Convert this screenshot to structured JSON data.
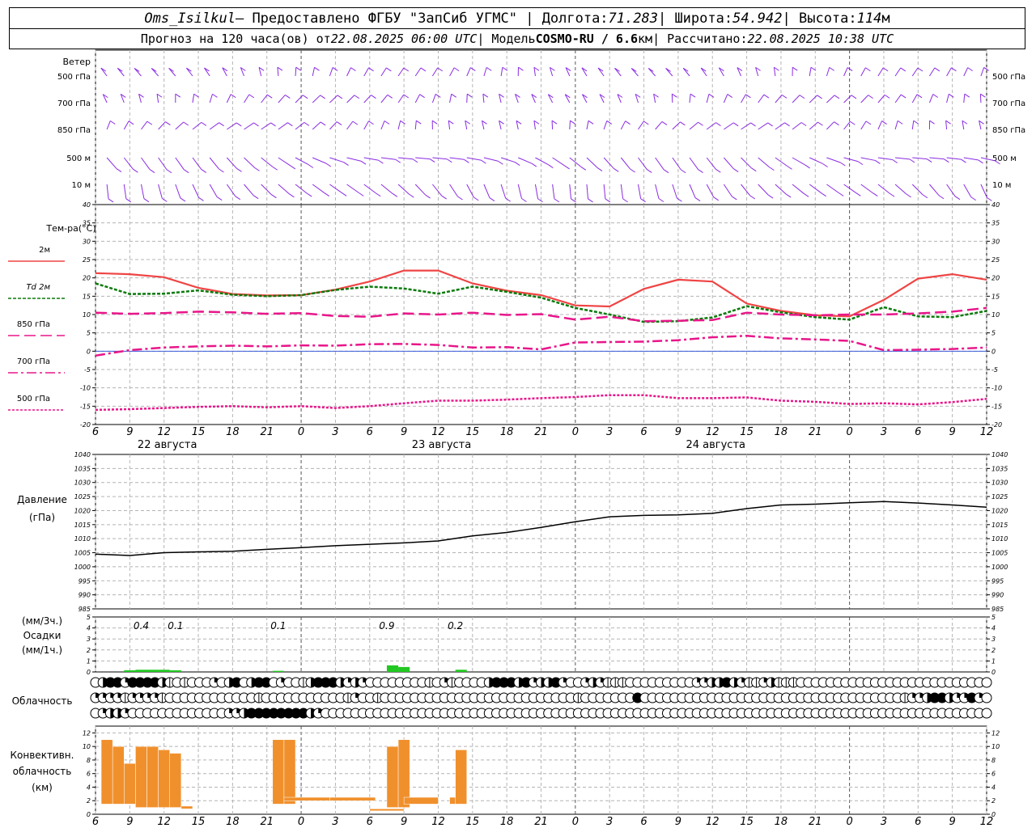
{
  "header": {
    "station": "Oms_Isilkul",
    "provider_prefix": " – Предоставлено ФГБУ \"ЗапСиб УГМС\" | Долгота: ",
    "longitude": "71.283",
    "lat_prefix": " | Широта: ",
    "latitude": "54.942",
    "alt_prefix": " | Высота: ",
    "altitude": "114",
    "alt_unit": "м",
    "forecast_prefix": "Прогноз на 120 часа(ов) от ",
    "forecast_start": "22.08.2025 06:00 UTC",
    "model_prefix": "  | Модель ",
    "model": "COSMO-RU / 6.6",
    "model_unit": "км",
    "calc_prefix": " | Рассчитано: ",
    "calculated": "22.08.2025 10:38 UTC"
  },
  "colors": {
    "wind": "#8a2be2",
    "t2m": "#ef4444",
    "td2m": "#0a7a0a",
    "t850": "#e8168a",
    "t700": "#e8168a",
    "t500": "#e8168a",
    "pressure": "#000000",
    "precip": "#22c822",
    "convective": "#f0902c",
    "grid": "#b4b4b4"
  },
  "time_axis": {
    "hour_labels": [
      "6",
      "9",
      "12",
      "15",
      "18",
      "21",
      "0",
      "3",
      "6",
      "9",
      "12",
      "15",
      "18",
      "21",
      "0",
      "3",
      "6",
      "9",
      "12",
      "15",
      "18",
      "21",
      "0",
      "3",
      "6",
      "9",
      "12"
    ],
    "day_labels": [
      "22 августа",
      "23 августа",
      "24 августа"
    ]
  },
  "wind_panel": {
    "title": "Ветер",
    "levels": [
      "500 гПа",
      "700 гПа",
      "850 гПа",
      "500 м",
      "10 м"
    ]
  },
  "chart_data": [
    {
      "type": "line",
      "title": "Тем-ра(°C)",
      "x": [
        6,
        9,
        12,
        15,
        18,
        21,
        24,
        27,
        30,
        33,
        36,
        39,
        42,
        45,
        48,
        51,
        54,
        57,
        60,
        63,
        66,
        69,
        72,
        75,
        78,
        81,
        84
      ],
      "ylim": [
        -20,
        40
      ],
      "yticks": [
        -20,
        -15,
        -10,
        -5,
        0,
        5,
        10,
        15,
        20,
        25,
        30,
        35,
        40
      ],
      "series": [
        {
          "name": "2м",
          "values": [
            21.3,
            21.0,
            20.2,
            17.3,
            15.6,
            15.2,
            15.3,
            16.8,
            19.0,
            22.0,
            22.0,
            18.5,
            16.5,
            15.3,
            12.5,
            12.2,
            17.0,
            19.5,
            19.0,
            13.0,
            11.0,
            9.8,
            9.5,
            14.0,
            19.8,
            21.0,
            19.5
          ]
        },
        {
          "name": "Td 2м",
          "values": [
            18.5,
            15.6,
            15.7,
            16.6,
            15.4,
            15.0,
            15.3,
            16.7,
            17.6,
            17.1,
            15.7,
            17.6,
            16.2,
            14.6,
            11.8,
            10.0,
            8.0,
            8.2,
            9.2,
            12.3,
            10.6,
            9.3,
            8.6,
            12.0,
            9.5,
            9.3,
            11.0
          ]
        },
        {
          "name": "850 гПа",
          "values": [
            10.5,
            10.2,
            10.4,
            10.8,
            10.6,
            10.2,
            10.4,
            9.6,
            9.4,
            10.3,
            10.0,
            10.5,
            9.9,
            10.1,
            8.6,
            9.4,
            8.2,
            8.3,
            8.5,
            10.5,
            10.0,
            9.8,
            10.0,
            10.0,
            10.3,
            10.8,
            11.8
          ]
        },
        {
          "name": "700 гПа",
          "values": [
            -1.2,
            0.3,
            1.0,
            1.3,
            1.5,
            1.3,
            1.6,
            1.5,
            1.9,
            2.0,
            1.7,
            1.0,
            1.1,
            0.5,
            2.4,
            2.5,
            2.6,
            3.0,
            3.8,
            4.2,
            3.5,
            3.2,
            2.8,
            0.3,
            0.4,
            0.6,
            1.0
          ]
        },
        {
          "name": "500 гПа",
          "values": [
            -16.0,
            -15.8,
            -15.5,
            -15.2,
            -15.0,
            -15.3,
            -15.0,
            -15.5,
            -15.0,
            -14.2,
            -13.5,
            -13.5,
            -13.2,
            -12.8,
            -12.5,
            -12.0,
            -12.0,
            -12.8,
            -12.8,
            -12.6,
            -13.5,
            -13.8,
            -14.4,
            -14.2,
            -14.5,
            -13.9,
            -13.0
          ]
        }
      ]
    },
    {
      "type": "line",
      "title": "Давление",
      "ylabel": "(гПа)",
      "x": [
        6,
        9,
        12,
        15,
        18,
        21,
        24,
        27,
        30,
        33,
        36,
        39,
        42,
        45,
        48,
        51,
        54,
        57,
        60,
        63,
        66,
        69,
        72,
        75,
        78,
        81,
        84
      ],
      "ylim": [
        985,
        1040
      ],
      "yticks": [
        985,
        990,
        995,
        1000,
        1005,
        1010,
        1015,
        1020,
        1025,
        1030,
        1035,
        1040
      ],
      "series": [
        {
          "name": "Давление",
          "values": [
            1004.5,
            1004.0,
            1005.0,
            1005.3,
            1005.5,
            1006.2,
            1006.8,
            1007.5,
            1008.0,
            1008.5,
            1009.2,
            1011.0,
            1012.2,
            1014.0,
            1016.0,
            1017.8,
            1018.3,
            1018.5,
            1019.0,
            1020.7,
            1022.0,
            1022.3,
            1022.8,
            1023.2,
            1022.7,
            1022.0,
            1021.2
          ]
        }
      ]
    },
    {
      "type": "bar",
      "title": "Осадки",
      "ylabel_top": "(мм/3ч.)",
      "ylabel_bottom": "(мм/1ч.)",
      "ylim": [
        0,
        5
      ],
      "yticks": [
        0,
        1,
        2,
        3,
        4,
        5
      ],
      "hourly": [
        {
          "hour": 9,
          "value": 0.15
        },
        {
          "hour": 10,
          "value": 0.2
        },
        {
          "hour": 11,
          "value": 0.2
        },
        {
          "hour": 12,
          "value": 0.2
        },
        {
          "hour": 13,
          "value": 0.15
        },
        {
          "hour": 22,
          "value": 0.1
        },
        {
          "hour": 32,
          "value": 0.6
        },
        {
          "hour": 33,
          "value": 0.45
        },
        {
          "hour": 38,
          "value": 0.2
        }
      ],
      "labels": [
        {
          "hour": 10,
          "text": "0.4"
        },
        {
          "hour": 13,
          "text": "0.1"
        },
        {
          "hour": 22,
          "text": "0.1"
        },
        {
          "hour": 31.5,
          "text": "0.9"
        },
        {
          "hour": 37.5,
          "text": "0.2"
        }
      ]
    },
    {
      "type": "table",
      "title": "Облачность",
      "x_start_hour": 6,
      "step_hours": 1,
      "scale": "0 = ясно, 4 = сплошная",
      "rows": [
        [
          0,
          3,
          4,
          4,
          2,
          4,
          4,
          4,
          4,
          3,
          1,
          0,
          1,
          0,
          0,
          0,
          2,
          0,
          3,
          4,
          0,
          3,
          4,
          4,
          0,
          2,
          0,
          0,
          1,
          3,
          4,
          4,
          4,
          3,
          2,
          3,
          2,
          0,
          0,
          0,
          0,
          0,
          0,
          0,
          0,
          1,
          0,
          2,
          1,
          0,
          0,
          0,
          0,
          3,
          4,
          4,
          4,
          3,
          4,
          2,
          3,
          3,
          4,
          2,
          0,
          0,
          2,
          3,
          2,
          1,
          1,
          1,
          0,
          0,
          0,
          0,
          0,
          0,
          0,
          0,
          0,
          2,
          2,
          3,
          3,
          4,
          3,
          2,
          1,
          1,
          2,
          3,
          1,
          1,
          1,
          0,
          0,
          0,
          0,
          0,
          0,
          0,
          0,
          0,
          0,
          0,
          0,
          0,
          0,
          0,
          0,
          0,
          0,
          0,
          0,
          0,
          0,
          0,
          0,
          0,
          0
        ],
        [
          2,
          2,
          2,
          2,
          1,
          2,
          2,
          2,
          2,
          1,
          0,
          0,
          0,
          0,
          0,
          0,
          0,
          0,
          0,
          0,
          0,
          0,
          1,
          0,
          0,
          0,
          0,
          0,
          0,
          0,
          0,
          0,
          0,
          0,
          1,
          2,
          0,
          0,
          1,
          0,
          0,
          0,
          0,
          0,
          0,
          0,
          0,
          0,
          0,
          0,
          0,
          0,
          0,
          0,
          0,
          0,
          0,
          0,
          0,
          0,
          0,
          0,
          0,
          0,
          0,
          1,
          0,
          0,
          0,
          0,
          0,
          0,
          0,
          4,
          0,
          0,
          0,
          0,
          0,
          0,
          0,
          0,
          0,
          0,
          0,
          0,
          0,
          0,
          0,
          0,
          0,
          0,
          0,
          0,
          0,
          0,
          0,
          0,
          0,
          0,
          0,
          0,
          0,
          0,
          0,
          0,
          0,
          0,
          0,
          1,
          2,
          2,
          3,
          4,
          4,
          3,
          2,
          2,
          4,
          2,
          0
        ],
        [
          0,
          2,
          3,
          3,
          2,
          0,
          0,
          0,
          0,
          0,
          0,
          0,
          0,
          0,
          0,
          0,
          0,
          0,
          2,
          2,
          3,
          4,
          4,
          4,
          4,
          4,
          4,
          4,
          4,
          3,
          2,
          0,
          0,
          0,
          0,
          0,
          0,
          0,
          0,
          0,
          0,
          0,
          0,
          0,
          0,
          0,
          0,
          0,
          0,
          0,
          0,
          0,
          0,
          0,
          0,
          0,
          0,
          0,
          0,
          0,
          0,
          0,
          0,
          0,
          0,
          0,
          0,
          0,
          0,
          0,
          0,
          0,
          0,
          0,
          0,
          0,
          0,
          0,
          0,
          0,
          0,
          0,
          0,
          0,
          0,
          0,
          0,
          0,
          0,
          0,
          0,
          0,
          0,
          0,
          0,
          0,
          0,
          0,
          0,
          0,
          0,
          0,
          0,
          0,
          0,
          0,
          0,
          0,
          0,
          0,
          0,
          0,
          0,
          0,
          0,
          0,
          0,
          0,
          0,
          0,
          0
        ]
      ]
    },
    {
      "type": "bar",
      "title": "Конвективн. облачность",
      "ylabel": "(км)",
      "ylim": [
        0,
        13
      ],
      "yticks": [
        0,
        2,
        4,
        6,
        8,
        10,
        12
      ],
      "bars": [
        {
          "hour": 7,
          "base": 1.5,
          "top": 11.0
        },
        {
          "hour": 8,
          "base": 1.5,
          "top": 10.0
        },
        {
          "hour": 9,
          "base": 1.5,
          "top": 7.5
        },
        {
          "hour": 10,
          "base": 1.0,
          "top": 10.0
        },
        {
          "hour": 11,
          "base": 1.0,
          "top": 10.0
        },
        {
          "hour": 12,
          "base": 1.0,
          "top": 9.5
        },
        {
          "hour": 13,
          "base": 1.0,
          "top": 9.0
        },
        {
          "hour": 14,
          "base": 0.8,
          "top": 1.2
        },
        {
          "hour": 22,
          "base": 1.5,
          "top": 11.0
        },
        {
          "hour": 23,
          "base": 1.5,
          "top": 11.0
        },
        {
          "hour": 24.5,
          "base": 2.0,
          "top": 2.5,
          "width": 4
        },
        {
          "hour": 28.5,
          "base": 2.0,
          "top": 2.5,
          "width": 4
        },
        {
          "hour": 31.5,
          "base": 0.5,
          "top": 0.8,
          "width": 3
        },
        {
          "hour": 32,
          "base": 1.0,
          "top": 10.0
        },
        {
          "hour": 33,
          "base": 1.0,
          "top": 11.0
        },
        {
          "hour": 34.5,
          "base": 1.5,
          "top": 2.5,
          "width": 3
        },
        {
          "hour": 37.5,
          "base": 1.5,
          "top": 2.5
        },
        {
          "hour": 38,
          "base": 1.5,
          "top": 9.5
        }
      ]
    }
  ]
}
